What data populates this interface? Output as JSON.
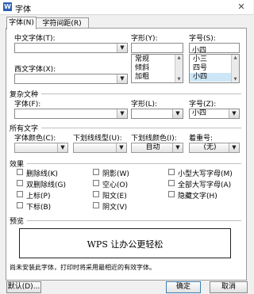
{
  "window": {
    "title": "字体",
    "app_icon_letter": "W",
    "close_symbol": "✕"
  },
  "tabs": [
    {
      "label": "字体(N)"
    },
    {
      "label": "字符间距(R)"
    }
  ],
  "chinese_font": {
    "label": "中文字体(T):",
    "value": ""
  },
  "western_font": {
    "label": "西文字体(X):",
    "value": ""
  },
  "font_style": {
    "label": "字形(Y):",
    "value": "",
    "options": [
      "常规",
      "倾斜",
      "加粗"
    ]
  },
  "font_size": {
    "label": "字号(S):",
    "value": "小四",
    "options": [
      "小三",
      "四号",
      "小四"
    ],
    "selected": "小四"
  },
  "complex": {
    "section": "复杂文种",
    "font_label": "字体(F):",
    "font_value": "",
    "style_label": "字形(L):",
    "style_value": "",
    "size_label": "字号(Z):",
    "size_value": "小四"
  },
  "all_text": {
    "section": "所有文字",
    "color_label": "字体颜色(C):",
    "color_value": "",
    "underline_label": "下划线线型(U):",
    "underline_value": "",
    "underline_color_label": "下划线颜色(I):",
    "underline_color_value": "自动",
    "emphasis_label": "着重号:",
    "emphasis_value": "(无)"
  },
  "effects": {
    "section": "效果",
    "col1": [
      "删除线(K)",
      "双删除线(G)",
      "上标(P)",
      "下标(B)"
    ],
    "col2": [
      "阴影(W)",
      "空心(O)",
      "阳文(E)",
      "阴文(V)"
    ],
    "col3": [
      "小型大写字母(M)",
      "全部大写字母(A)",
      "隐藏文字(H)"
    ]
  },
  "preview": {
    "section": "预览",
    "text": "WPS 让办公更轻松",
    "note": "尚未安装此字体，打印时将采用最相近的有效字体。"
  },
  "buttons": {
    "default": "默认(D)...",
    "ok": "确定",
    "cancel": "取消"
  },
  "icons": {
    "dropdown": "▼",
    "scroll_up": "▲",
    "scroll_down": "▼"
  }
}
